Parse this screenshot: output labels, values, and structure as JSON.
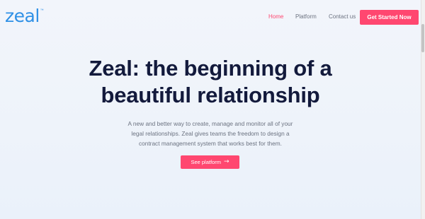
{
  "brand": {
    "logo_text": "zeal",
    "logo_mark": "™",
    "accent": "#ff4770",
    "logo_color": "#2f90e6"
  },
  "nav": {
    "links": [
      {
        "label": "Home",
        "active": true
      },
      {
        "label": "Platform",
        "active": false
      },
      {
        "label": "Contact us",
        "active": false
      }
    ],
    "cta_label": "Get Started Now"
  },
  "hero": {
    "title_line1": "Zeal: the beginning of a",
    "title_line2": "beautiful relationship",
    "description_line1": "A new and better way to create, manage and monitor all of your",
    "description_line2": "legal relationships. Zeal gives teams the freedom to design a",
    "description_line3": "contract management system that works best for them.",
    "cta_label": "See platform",
    "cta_icon": "arrow-right-icon",
    "cta_arrow": "→"
  }
}
